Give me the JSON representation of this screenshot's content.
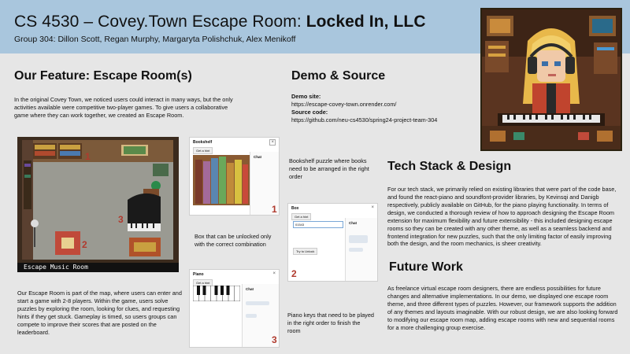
{
  "header": {
    "title_prefix": "CS 4530 – Covey.Town Escape Room: ",
    "title_bold": "Locked In, LLC",
    "authors": "Group 304: Dillon Scott, Regan Murphy, Margaryta Polishchuk, Alex Menikoff"
  },
  "feature": {
    "heading": "Our Feature: Escape Room(s)",
    "intro": "In the original Covey Town, we noticed users could interact in many ways, but the only activities available were competitive two-player games. To give users a collaborative game where they can work together, we created an Escape Room.",
    "map_caption": "Escape Music Room",
    "description": "Our Escape Room is part of the map, where users can enter and start a game with 2-8 players. Within the game, users solve puzzles by exploring the room, looking for clues, and requesting hints if they get stuck. Gameplay is timed, so users groups can compete to improve their scores that are posted on the leaderboard."
  },
  "puzzles": {
    "bookshelf": {
      "title": "Bookshelf",
      "button": "Get a hint",
      "chat": "Chat",
      "caption": "Bookshelf puzzle where books need to be arranged in the right order",
      "num": "1"
    },
    "box": {
      "title": "Box",
      "button": "Get a hint",
      "chat": "Chat",
      "input_value": "01543",
      "try_label": "Try to Unlock",
      "caption": "Box that can be unlocked only with the correct combination",
      "num": "2"
    },
    "piano": {
      "title": "Piano",
      "button": "Get a hint",
      "chat": "Chat",
      "caption": "Piano keys that need to be played in the right order to finish the room",
      "num": "3"
    }
  },
  "demo": {
    "heading": "Demo & Source",
    "site_label": "Demo site:",
    "site_url": "https://escape-covey-town.onrender.com/",
    "source_label": "Source code:",
    "source_url": "https://github.com/neu-cs4530/spring24-project-team-304"
  },
  "tech": {
    "heading": "Tech Stack & Design",
    "body": "For our tech stack, we primarily relied on existing libraries that were part of the code base, and found the react-piano and soundfont-provider libraries, by Kevinsqi and Danigb respectively, publicly available on GitHub, for the piano playing functionality. In terms of design, we conducted a thorough review of how to approach designing the Escape Room extension for maximum flexibility and future extensibility - this included designing escape rooms so they can be created with any other theme, as well as a seamless backend and frontend integration for new puzzles, such that the only limiting factor of easily improving both the design, and the room mechanics, is sheer creativity."
  },
  "future": {
    "heading": "Future Work",
    "body": "As freelance virtual escape room designers, there are endless possibilities for future changes and alternative implementations. In our demo, we displayed one escape room theme, and three different types of puzzles. However, our framework supports the addition of any themes and layouts imaginable. With our robust design, we are also looking forward to modifying our escape room map, adding escape rooms with new and sequential rooms for a more challenging group exercise."
  },
  "colors": {
    "header_bg": "#a9c6dd",
    "page_bg": "#e6e6e6",
    "marker": "#b03a2e"
  }
}
